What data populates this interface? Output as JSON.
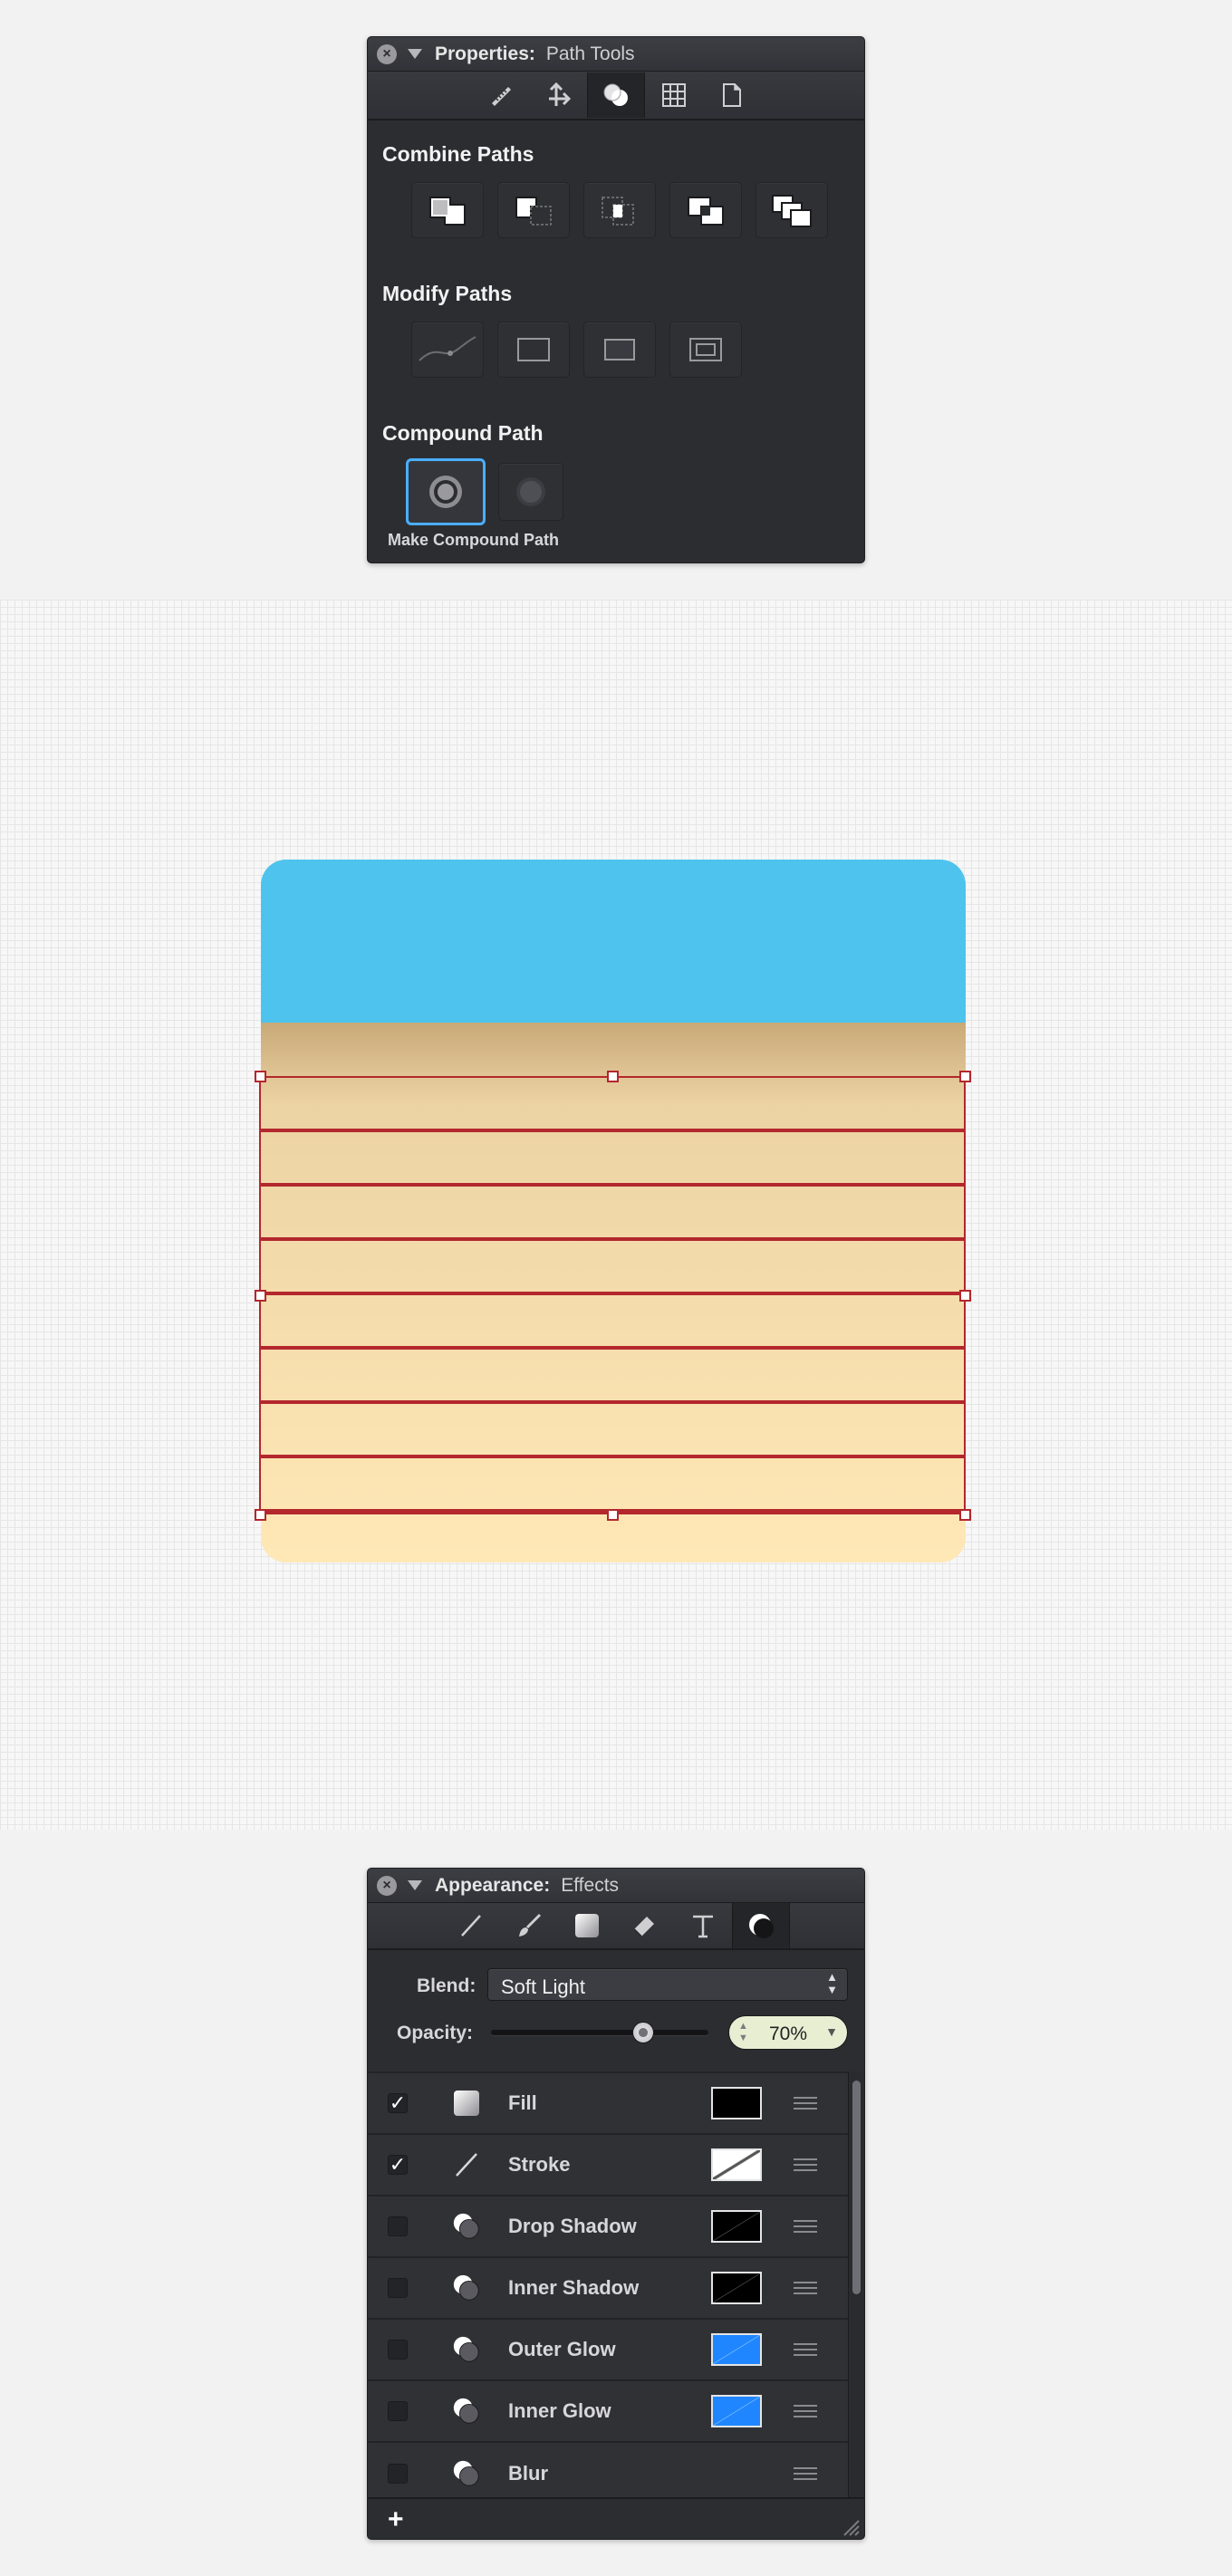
{
  "properties_panel": {
    "title": "Properties:",
    "subtitle": "Path Tools",
    "toolbar_icons": [
      "ruler-icon",
      "transform-icon",
      "path-tools-icon",
      "grid-icon",
      "document-icon"
    ],
    "combine_title": "Combine Paths",
    "combine_buttons": [
      "union-icon",
      "subtract-icon",
      "intersect-icon",
      "exclude-icon",
      "divide-icon"
    ],
    "modify_title": "Modify Paths",
    "modify_buttons": [
      "path-curve-icon",
      "rectangle-outline-icon",
      "rectangle-fill-icon",
      "offset-path-icon"
    ],
    "compound_title": "Compound Path",
    "compound_buttons": [
      "make-compound-icon",
      "release-compound-icon"
    ],
    "compound_caption": "Make Compound Path"
  },
  "artwork": {
    "sky_color": "#4ec3ee",
    "sand_top_color": "#c9a978",
    "sand_bottom_color": "#ffe8b6",
    "selection_color": "#b3272d",
    "stripe_count": 8
  },
  "appearance_panel": {
    "title": "Appearance:",
    "subtitle": "Effects",
    "toolbar_icons": [
      "line-tool-icon",
      "brush-icon",
      "fill-square-icon",
      "eraser-icon",
      "text-icon",
      "effects-icon"
    ],
    "blend_label": "Blend:",
    "blend_value": "Soft Light",
    "opacity_label": "Opacity:",
    "opacity_value": "70%",
    "opacity_fraction": 0.7,
    "effects": [
      {
        "label": "Fill",
        "checked": true,
        "checkmark": "✓",
        "icon": "fill-icon",
        "swatch": "black"
      },
      {
        "label": "Stroke",
        "checked": true,
        "checkmark": "✓",
        "icon": "stroke-icon",
        "swatch": "none"
      },
      {
        "label": "Drop Shadow",
        "checked": false,
        "checkmark": "",
        "icon": "shadow-icon",
        "swatch": "black-diag"
      },
      {
        "label": "Inner Shadow",
        "checked": false,
        "checkmark": "",
        "icon": "shadow-icon",
        "swatch": "black-diag"
      },
      {
        "label": "Outer Glow",
        "checked": false,
        "checkmark": "",
        "icon": "glow-icon",
        "swatch": "blue-diag"
      },
      {
        "label": "Inner Glow",
        "checked": false,
        "checkmark": "",
        "icon": "glow-icon",
        "swatch": "blue-diag"
      },
      {
        "label": "Blur",
        "checked": false,
        "checkmark": "",
        "icon": "blur-icon",
        "swatch": ""
      }
    ],
    "add_label": "+"
  }
}
